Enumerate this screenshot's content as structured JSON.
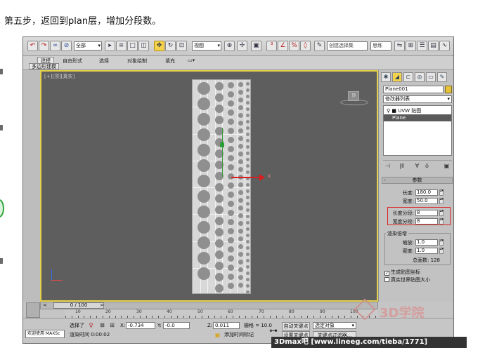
{
  "caption": "第五步，返回到plan层，增加分段数。",
  "toolbar": {
    "selection_filter": "全部",
    "view_select": "视图",
    "search_placeholder": "创建选择集",
    "search2": "思练"
  },
  "ribbon": {
    "tabs": [
      "建模",
      "自由形式",
      "选择",
      "对象绘制",
      "填充"
    ],
    "subtab": "多边形建模"
  },
  "viewport": {
    "label": "[+][顶][真实]",
    "axis_x_label": "X"
  },
  "command_panel": {
    "object_name": "Plane001",
    "modifier_list": "修改器列表",
    "stack": [
      {
        "label": "UVW 贴图",
        "selected": false
      },
      {
        "label": "Plane",
        "selected": true
      }
    ],
    "rollout_title": "参数",
    "params": {
      "length_label": "长度:",
      "length_value": "180.0",
      "width_label": "宽度:",
      "width_value": "50.0",
      "length_segs_label": "长度分段:",
      "length_segs_value": "8",
      "width_segs_label": "宽度分段:",
      "width_segs_value": "8"
    },
    "render_group": {
      "title": "渲染倍增",
      "scale_label": "缩放:",
      "scale_value": "1.0",
      "density_label": "密度:",
      "density_value": "1.0",
      "total_label": "总面数: 128"
    },
    "checkboxes": [
      {
        "label": "生成贴图坐标",
        "checked": true
      },
      {
        "label": "真实世界贴图大小",
        "checked": false
      }
    ]
  },
  "timeline": {
    "frame": "0 / 100",
    "ticks": [
      "10",
      "20",
      "30",
      "40",
      "50",
      "60",
      "70",
      "80",
      "90",
      "100"
    ]
  },
  "status": {
    "welcome": "欢迎使用 MAXSc",
    "selected": "选择了",
    "x_label": "X:",
    "x_value": "-0.734",
    "y_label": "Y:",
    "y_value": "-0.0",
    "z_label": "Z:",
    "z_value": "0.011",
    "grid": "栅格 = 10.0",
    "auto_key": "自动关键点",
    "set_key": "设置关键点",
    "selected_object": "选定对象",
    "key_filters": "关键点过滤器...",
    "render_time": "渲染时间 0:00:02",
    "add_time_tag": "添加时间标记"
  },
  "watermark": {
    "logo_text": "3D学院",
    "bar_text": "3Dmax吧 [www.lineeg.com/tieba/1771]"
  },
  "colors": {
    "viewport_bg": "#5e5e5e",
    "viewport_border": "#e5d24a",
    "highlight_box": "#dd2222"
  }
}
